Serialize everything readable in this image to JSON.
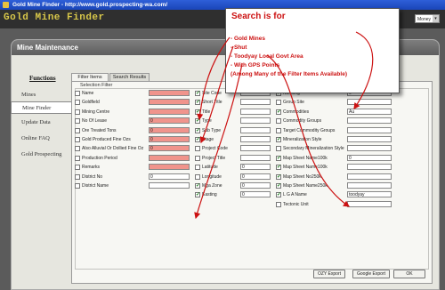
{
  "window": {
    "title": "Gold Mine Finder - http://www.gold.prospecting-wa.com/"
  },
  "app": {
    "brand": "Gold Mine Finder",
    "select_value": "Money"
  },
  "panel": {
    "title": "Mine Maintenance"
  },
  "functions": {
    "title": "Functions",
    "items": [
      "Mines",
      "Mine Finder",
      "Update Data",
      "Online FAQ",
      "Gold Prospecting"
    ],
    "active_index": 1
  },
  "tabs": [
    "Filter Items",
    "Search Results"
  ],
  "selection_filter_label": "Selection Filter",
  "col1": [
    {
      "label": "Name",
      "checked": false,
      "value": "",
      "pink": true
    },
    {
      "label": "Goldfield",
      "checked": false,
      "value": "",
      "pink": true
    },
    {
      "label": "Mining Centre",
      "checked": false,
      "value": "",
      "pink": true
    },
    {
      "label": "No Of Lease",
      "checked": false,
      "value": "0",
      "pink": true
    },
    {
      "label": "Ore Treated Tons",
      "checked": false,
      "value": "0",
      "pink": true
    },
    {
      "label": "Gold Produced Fine Ozs",
      "checked": false,
      "value": "0",
      "pink": true
    },
    {
      "label": "Also Alluvial Or Dollied Fine Oz",
      "checked": false,
      "value": "0",
      "pink": true
    },
    {
      "label": "Production Period",
      "checked": false,
      "value": "",
      "pink": true
    },
    {
      "label": "Remarks",
      "checked": false,
      "value": "",
      "pink": true
    },
    {
      "label": "District No",
      "checked": false,
      "value": "0",
      "pink": false
    },
    {
      "label": "District Name",
      "checked": false,
      "value": "",
      "pink": false
    }
  ],
  "col2": [
    {
      "label": "Site Code",
      "checked": true
    },
    {
      "label": "Short Title",
      "checked": true
    },
    {
      "label": "Title",
      "checked": true
    },
    {
      "label": "Type",
      "checked": true
    },
    {
      "label": "Sub Type",
      "checked": true
    },
    {
      "label": "Stage",
      "checked": true
    },
    {
      "label": "Project Code",
      "checked": false
    },
    {
      "label": "Project Title",
      "checked": false
    },
    {
      "label": "Latitude",
      "checked": false,
      "value": "0"
    },
    {
      "label": "Longitude",
      "checked": false,
      "value": "0"
    },
    {
      "label": "Mga Zone",
      "checked": true,
      "value": "0"
    },
    {
      "label": "Easting",
      "checked": true,
      "value": "0"
    }
  ],
  "col3": [
    {
      "label": "Northing",
      "checked": true,
      "value": "0"
    },
    {
      "label": "Group Site",
      "checked": false,
      "value": ""
    },
    {
      "label": "Commodities",
      "checked": true,
      "value": "Au"
    },
    {
      "label": "Commodity Groups",
      "checked": false,
      "value": ""
    },
    {
      "label": "Target Commodity Groups",
      "checked": false,
      "value": ""
    },
    {
      "label": "Mineralization Style",
      "checked": true,
      "value": ""
    },
    {
      "label": "Secondary Mineralization Style",
      "checked": false,
      "value": ""
    },
    {
      "label": "Map Sheet Name100k",
      "checked": true,
      "value": "0"
    },
    {
      "label": "Map Sheet Name100k",
      "checked": true,
      "value": ""
    },
    {
      "label": "Map Sheet No250k",
      "checked": true,
      "value": ""
    },
    {
      "label": "Map Sheet Name250k",
      "checked": true,
      "value": ""
    },
    {
      "label": "L G A Name",
      "checked": true,
      "value": "toodyay"
    },
    {
      "label": "Tectonic Unit",
      "checked": false,
      "value": ""
    }
  ],
  "buttons": {
    "ozy": "OZY Export",
    "google": "Google Export",
    "ok": "OK"
  },
  "callout": {
    "heading": "Search is for",
    "lines": [
      "- Gold Mines",
      "- Shut",
      "- Toodyay Local Govt Area",
      "- With GPS Points",
      "(Among Many of the Filter Items Available)"
    ]
  },
  "colors": {
    "callout_text": "#cc1111",
    "required_field": "#f0948c",
    "brand": "#d9c84a"
  }
}
